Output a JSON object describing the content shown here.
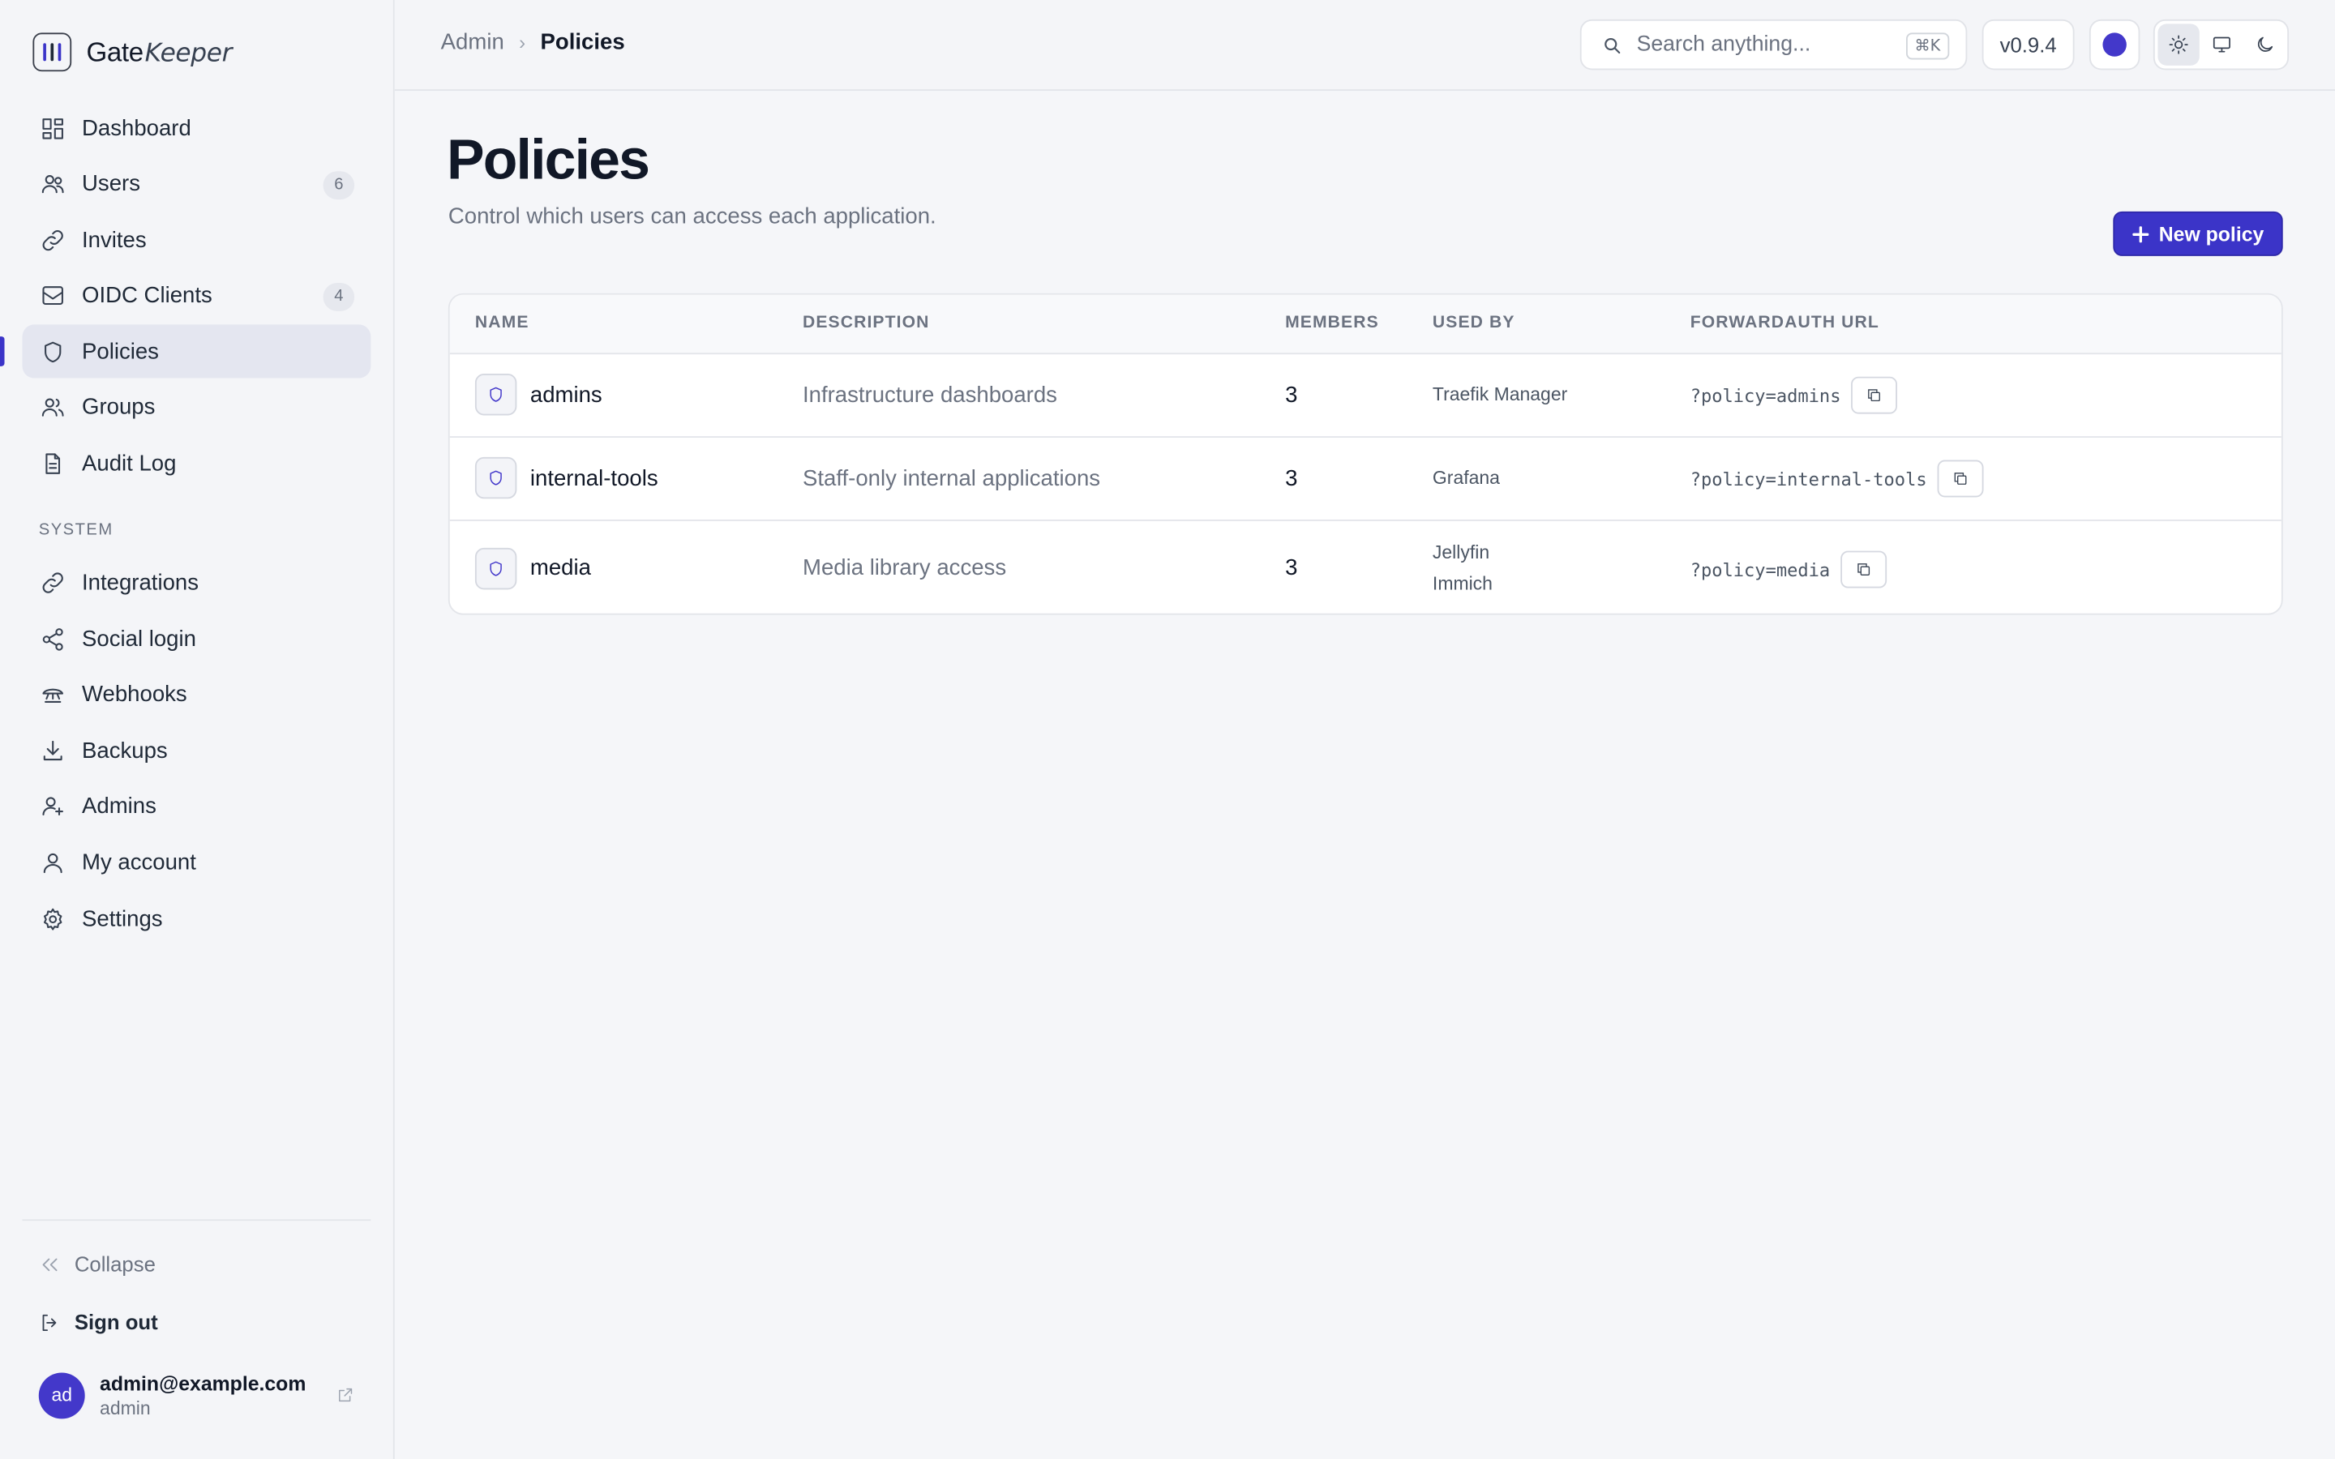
{
  "brand": {
    "name_gate": "Gate",
    "name_keeper": "Keeper"
  },
  "sidebar": {
    "items": [
      {
        "label": "Dashboard",
        "icon": "dashboard-icon"
      },
      {
        "label": "Users",
        "icon": "users-icon",
        "badge": "6"
      },
      {
        "label": "Invites",
        "icon": "link-icon"
      },
      {
        "label": "OIDC Clients",
        "icon": "inbox-icon",
        "badge": "4"
      },
      {
        "label": "Policies",
        "icon": "shield-icon",
        "active": true
      },
      {
        "label": "Groups",
        "icon": "group-icon"
      },
      {
        "label": "Audit Log",
        "icon": "document-icon"
      }
    ],
    "section_label": "SYSTEM",
    "system_items": [
      {
        "label": "Integrations",
        "icon": "link-icon"
      },
      {
        "label": "Social login",
        "icon": "share-icon"
      },
      {
        "label": "Webhooks",
        "icon": "webhook-icon"
      },
      {
        "label": "Backups",
        "icon": "download-icon"
      },
      {
        "label": "Admins",
        "icon": "user-plus-icon"
      },
      {
        "label": "My account",
        "icon": "user-icon"
      },
      {
        "label": "Settings",
        "icon": "gear-icon"
      }
    ],
    "collapse_label": "Collapse",
    "signout_label": "Sign out",
    "account": {
      "initials": "ad",
      "email": "admin@example.com",
      "role": "admin"
    }
  },
  "header": {
    "breadcrumb_root": "Admin",
    "breadcrumb_sep": "›",
    "breadcrumb_current": "Policies",
    "search_placeholder": "Search anything...",
    "search_shortcut": "⌘K",
    "version": "v0.9.4",
    "accent_color": "#4338ca"
  },
  "main": {
    "title": "Policies",
    "subtitle": "Control which users can access each application.",
    "new_button_label": "New policy",
    "columns": [
      "NAME",
      "DESCRIPTION",
      "MEMBERS",
      "USED BY",
      "FORWARDAUTH URL"
    ],
    "rows": [
      {
        "name": "admins",
        "description": "Infrastructure dashboards",
        "members": "3",
        "used_by": [
          "Traefik Manager"
        ],
        "url": "?policy=admins"
      },
      {
        "name": "internal-tools",
        "description": "Staff-only internal applications",
        "members": "3",
        "used_by": [
          "Grafana"
        ],
        "url": "?policy=internal-tools"
      },
      {
        "name": "media",
        "description": "Media library access",
        "members": "3",
        "used_by": [
          "Jellyfin",
          "Immich"
        ],
        "url": "?policy=media"
      }
    ]
  },
  "colors": {
    "accent": "#3b34c8",
    "background": "#f5f6f9"
  }
}
